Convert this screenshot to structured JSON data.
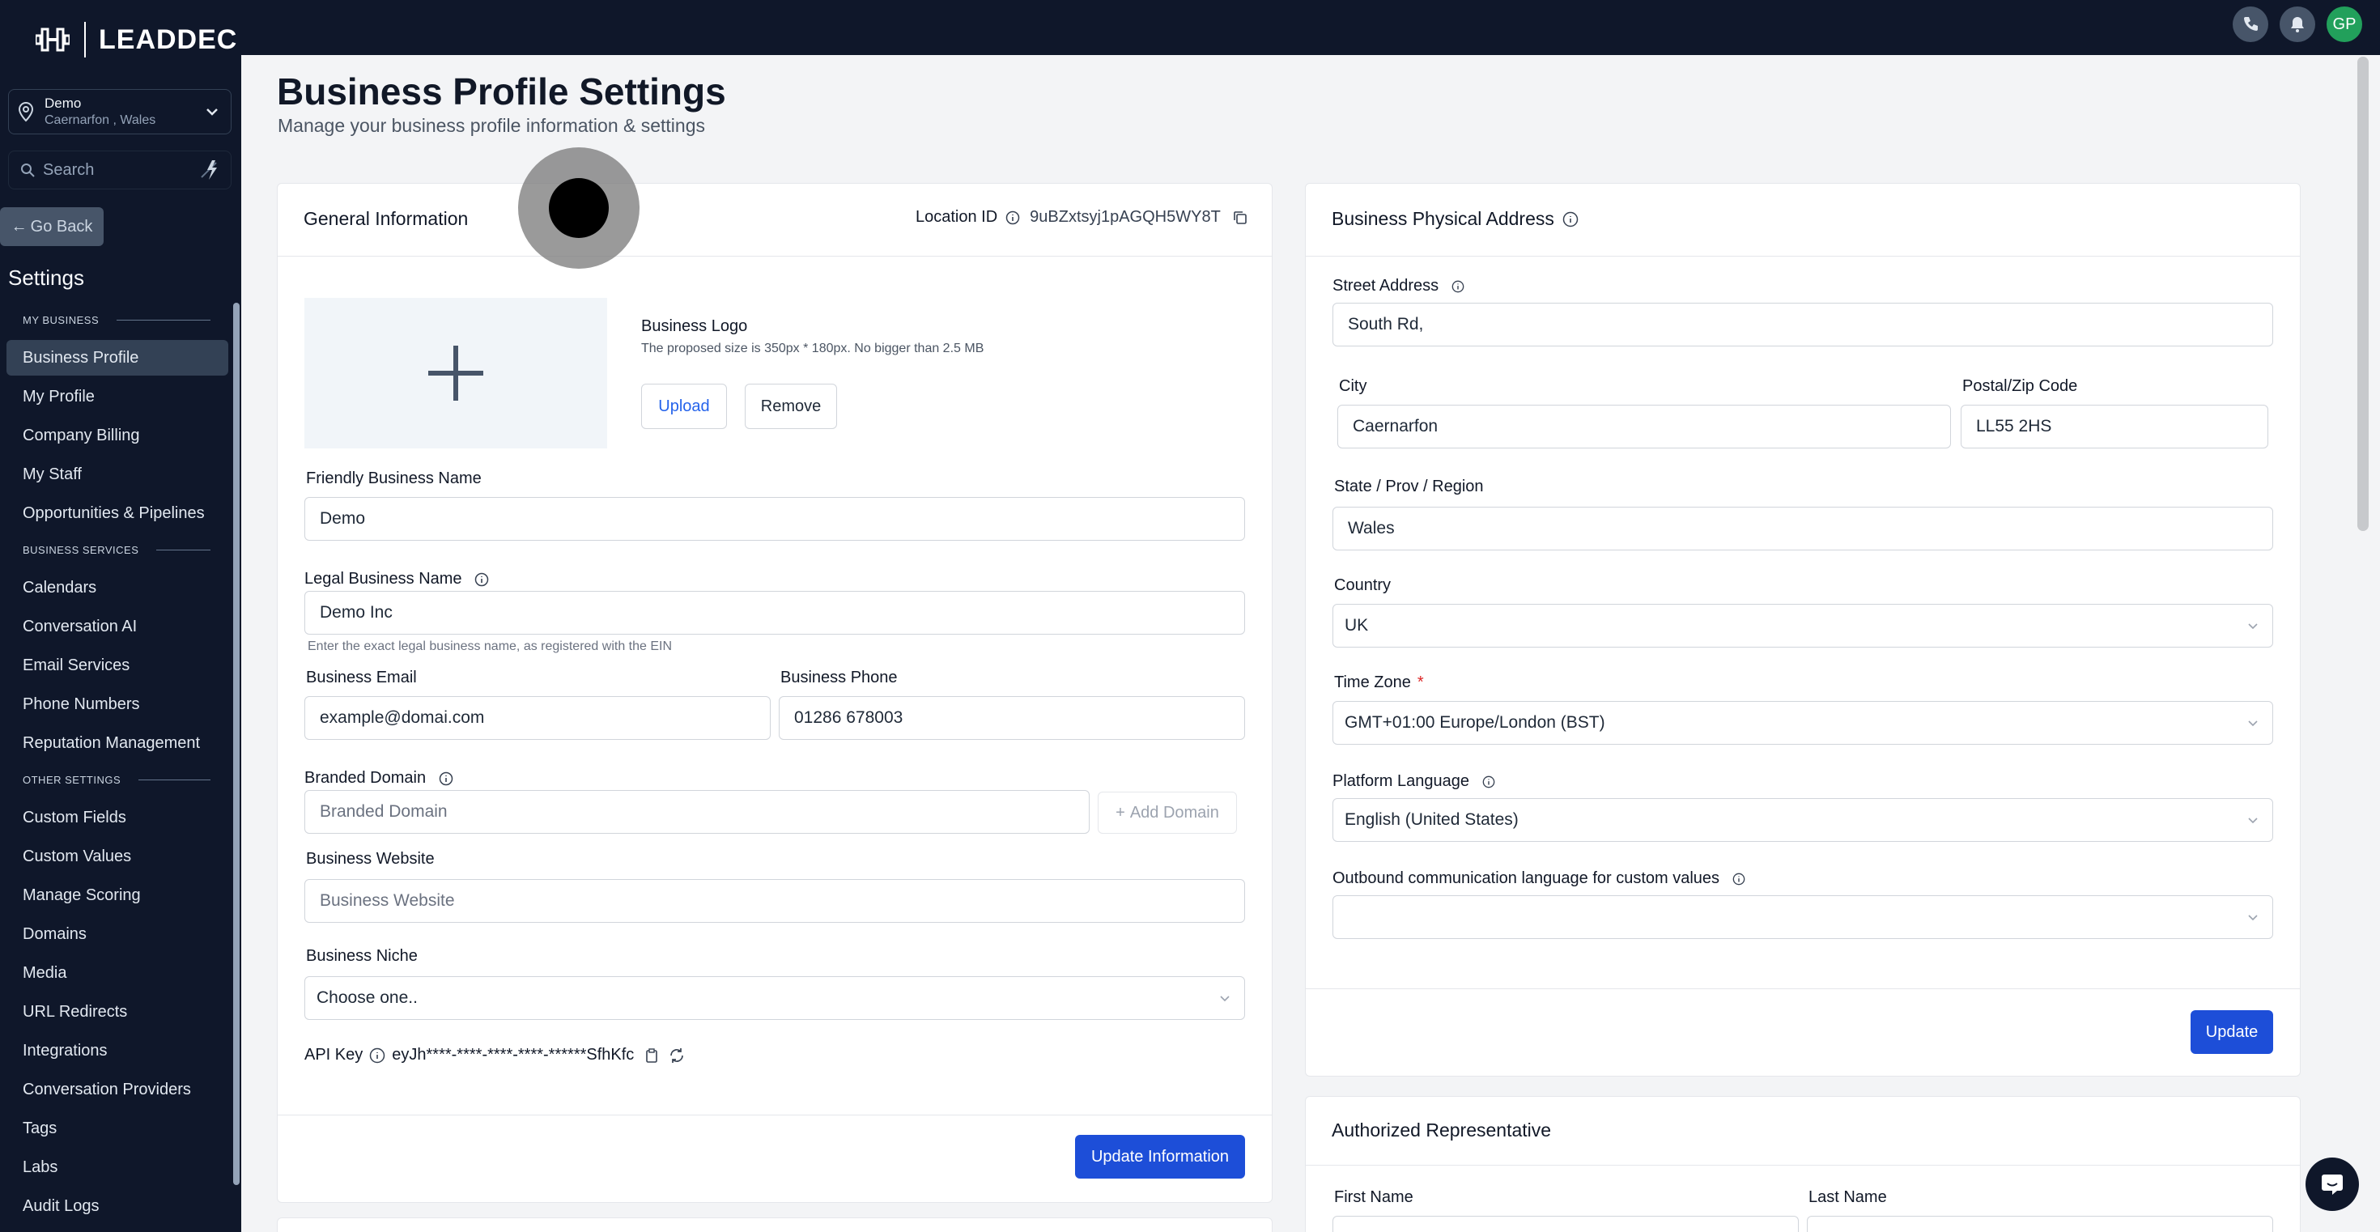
{
  "sidebar": {
    "brand": "LEADDEC",
    "location": {
      "name": "Demo",
      "address": "Caernarfon , Wales"
    },
    "search_placeholder": "Search",
    "go_back": "Go Back",
    "settings_title": "Settings",
    "sections": [
      {
        "title": "MY BUSINESS",
        "items": [
          "Business Profile",
          "My Profile",
          "Company Billing",
          "My Staff",
          "Opportunities & Pipelines"
        ]
      },
      {
        "title": "BUSINESS SERVICES",
        "items": [
          "Calendars",
          "Conversation AI",
          "Email Services",
          "Phone Numbers",
          "Reputation Management"
        ]
      },
      {
        "title": "OTHER SETTINGS",
        "items": [
          "Custom Fields",
          "Custom Values",
          "Manage Scoring",
          "Domains",
          "Media",
          "URL Redirects",
          "Integrations",
          "Conversation Providers",
          "Tags",
          "Labs",
          "Audit Logs"
        ]
      }
    ],
    "active_item": "Business Profile"
  },
  "topbar": {
    "avatar_initials": "GP"
  },
  "page": {
    "title": "Business Profile Settings",
    "subtitle": "Manage your business profile information & settings"
  },
  "general": {
    "title": "General Information",
    "location_id_label": "Location ID",
    "location_id": "9uBZxtsyj1pAGQH5WY8T",
    "logo_label": "Business Logo",
    "logo_hint": "The proposed size is 350px * 180px. No bigger than 2.5 MB",
    "upload": "Upload",
    "remove": "Remove",
    "friendly_name_label": "Friendly Business Name",
    "friendly_name": "Demo",
    "legal_name_label": "Legal Business Name",
    "legal_name": "Demo Inc",
    "legal_name_hint": "Enter the exact legal business name, as registered with the EIN",
    "email_label": "Business Email",
    "email": "example@domai.com",
    "phone_label": "Business Phone",
    "phone": "01286 678003",
    "domain_label": "Branded Domain",
    "domain_placeholder": "Branded Domain",
    "add_domain": "Add Domain",
    "website_label": "Business Website",
    "website_placeholder": "Business Website",
    "niche_label": "Business Niche",
    "niche_value": "Choose one..",
    "api_key_label": "API Key",
    "api_key": "eyJh****-****-****-****-******SfhKfc",
    "update_button": "Update Information"
  },
  "address": {
    "title": "Business Physical Address",
    "street_label": "Street Address",
    "street": "South Rd,",
    "city_label": "City",
    "city": "Caernarfon",
    "postal_label": "Postal/Zip Code",
    "postal": "LL55 2HS",
    "state_label": "State / Prov / Region",
    "state": "Wales",
    "country_label": "Country",
    "country": "UK",
    "tz_label": "Time Zone",
    "tz_required": "*",
    "tz": "GMT+01:00 Europe/London (BST)",
    "lang_label": "Platform Language",
    "lang": "English (United States)",
    "outbound_label": "Outbound communication language for custom values",
    "outbound": "",
    "update_button": "Update"
  },
  "representative": {
    "title": "Authorized Representative",
    "first_label": "First Name",
    "last_label": "Last Name"
  },
  "colors": {
    "sidebar_bg": "#0f172a",
    "primary": "#1d4ed8",
    "avatar": "#22a05b"
  }
}
